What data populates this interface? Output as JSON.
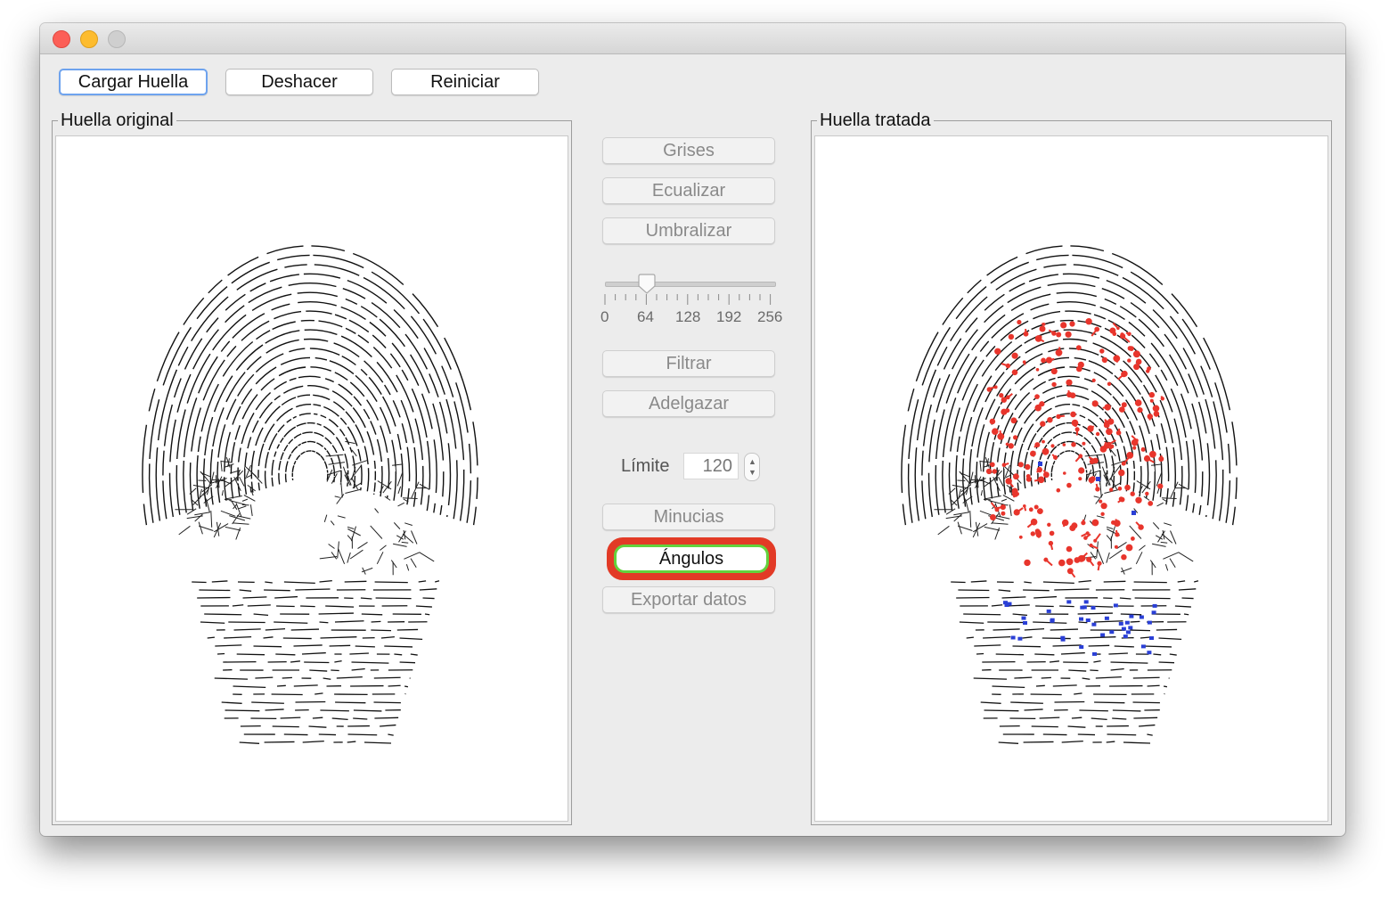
{
  "toolbar": {
    "load_label": "Cargar Huella",
    "undo_label": "Deshacer",
    "reset_label": "Reiniciar"
  },
  "panels": {
    "original_title": "Huella original",
    "processed_title": "Huella tratada"
  },
  "controls": {
    "grises": "Grises",
    "ecualizar": "Ecualizar",
    "umbralizar": "Umbralizar",
    "filtrar": "Filtrar",
    "adelgazar": "Adelgazar",
    "minucias": "Minucias",
    "angulos": "Ángulos",
    "exportar": "Exportar datos"
  },
  "slider": {
    "min": 0,
    "max": 256,
    "value": 64,
    "tick_labels": [
      "0",
      "64",
      "128",
      "192",
      "256"
    ]
  },
  "limit": {
    "label": "Límite",
    "value": "120"
  },
  "colors": {
    "close": "#fc5f57",
    "minimize": "#fdbc2e",
    "maximize": "#cfcfcf",
    "minutia_red": "#e8352c",
    "minutia_blue": "#2a3fd6",
    "highlight_ring": "#e23a26",
    "highlight_inner": "#63d23c"
  }
}
